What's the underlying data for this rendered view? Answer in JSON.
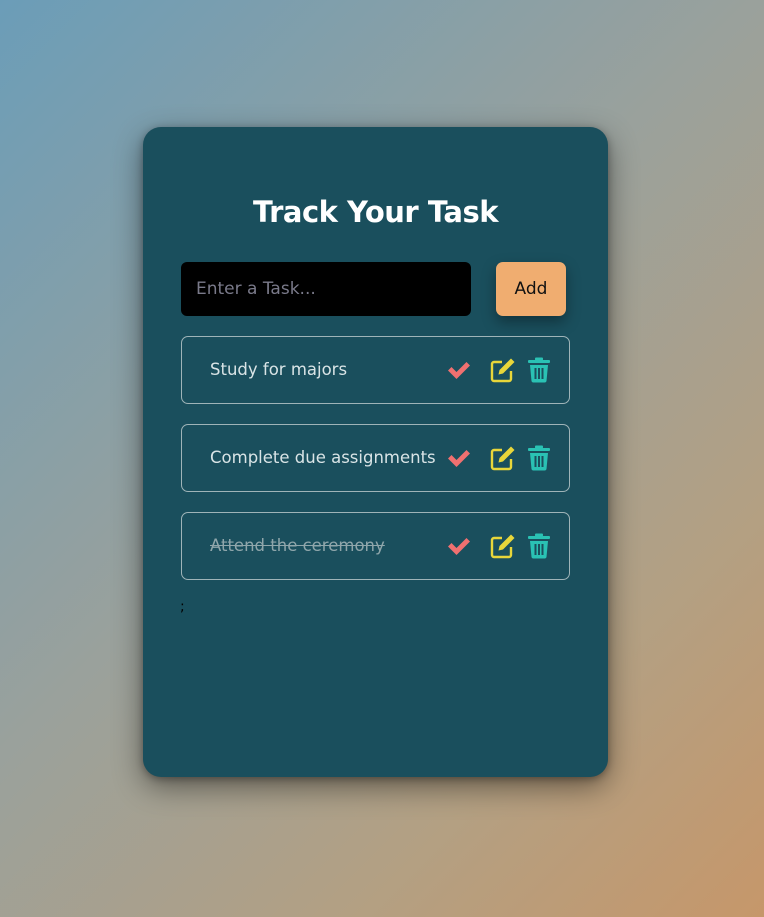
{
  "header": {
    "title": "Track Your Task"
  },
  "input": {
    "placeholder": "Enter a Task...",
    "value": ""
  },
  "add_button": {
    "label": "Add"
  },
  "tasks": [
    {
      "text": "Study for majors",
      "completed": false
    },
    {
      "text": "Complete due assignments",
      "completed": false
    },
    {
      "text": "Attend the ceremony",
      "completed": true
    }
  ],
  "stray_text": ";",
  "colors": {
    "card_bg": "#1a4f5d",
    "add_button": "#f0ad70",
    "check_icon": "#f07070",
    "edit_icon": "#e8d63a",
    "trash_icon": "#2ac2b4"
  },
  "icons": {
    "check": "check-icon",
    "edit": "edit-icon",
    "trash": "trash-icon"
  }
}
